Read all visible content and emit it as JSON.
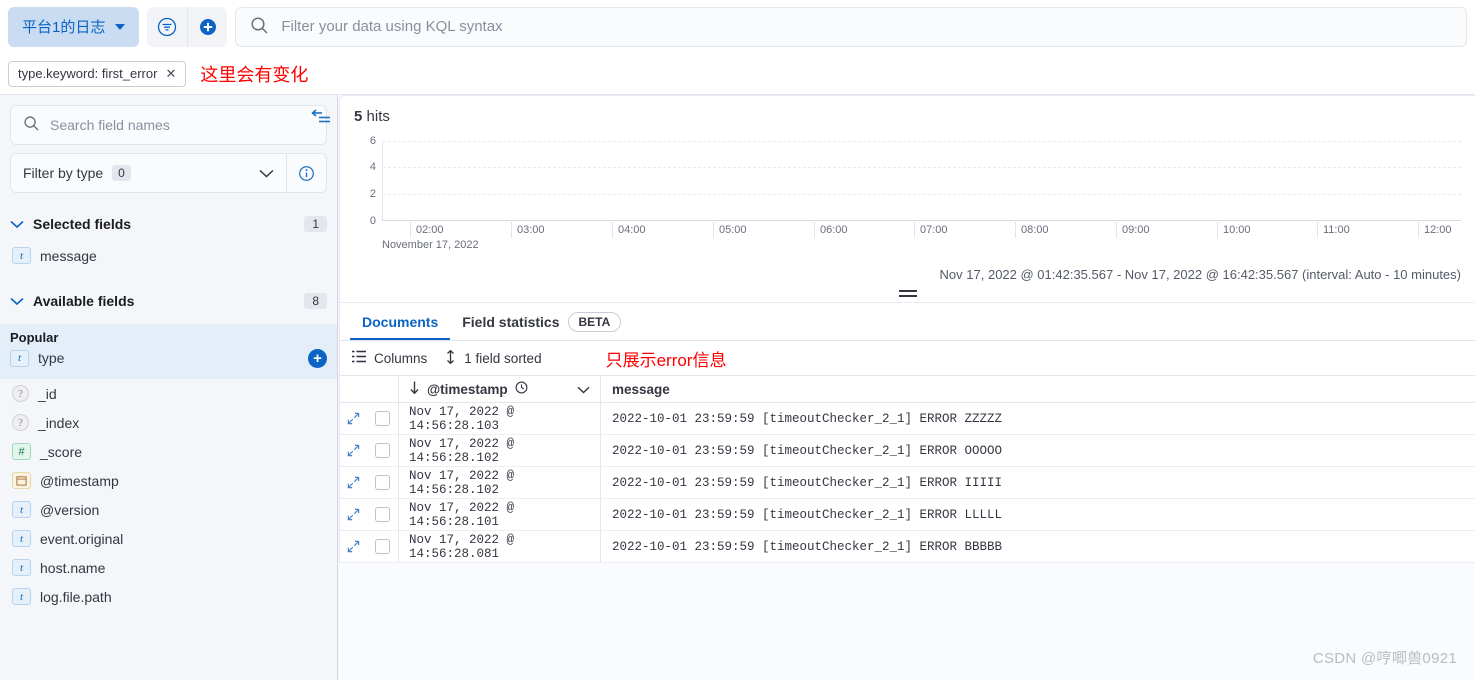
{
  "query_bar": {
    "data_view_label": "平台1的日志",
    "data_view_icon": "chevron-down-icon",
    "filter_icon": "filter-funnel-icon",
    "add_filter_icon": "add-plus-icon",
    "search_icon": "search-icon",
    "kql_placeholder": "Filter your data using KQL syntax",
    "kql_value": ""
  },
  "filter_bar": {
    "filters": [
      {
        "label": "type.keyword: first_error",
        "remove_icon": "close-x-icon"
      }
    ],
    "annotation": "这里会有变化",
    "annotation_color": "#FF0000"
  },
  "sidebar": {
    "search_placeholder": "Search field names",
    "search_value": "",
    "search_icon": "search-icon",
    "type_filter_label": "Filter by type",
    "type_filter_count": "0",
    "type_filter_caret": "chevron-down-icon",
    "info_icon": "info-circle-icon",
    "collapse_icon": "collapse-sidebar-icon",
    "sections": [
      {
        "title": "Selected fields",
        "count": "1",
        "collapse_icon": "chevron-down-icon",
        "fields": [
          {
            "name": "message",
            "type": "t"
          }
        ]
      },
      {
        "title": "Available fields",
        "count": "8",
        "collapse_icon": "chevron-down-icon",
        "popular_label": "Popular",
        "popular_fields": [
          {
            "name": "type",
            "type": "t",
            "add_icon": "add-field-icon"
          }
        ],
        "fields": [
          {
            "name": "_id",
            "type": "q",
            "glyph": "?"
          },
          {
            "name": "_index",
            "type": "q",
            "glyph": "?"
          },
          {
            "name": "_score",
            "type": "num",
            "glyph": "#"
          },
          {
            "name": "@timestamp",
            "type": "date",
            "glyph": "▤"
          },
          {
            "name": "@version",
            "type": "t",
            "glyph": "t"
          },
          {
            "name": "event.original",
            "type": "t",
            "glyph": "t"
          },
          {
            "name": "host.name",
            "type": "t",
            "glyph": "t"
          },
          {
            "name": "log.file.path",
            "type": "t",
            "glyph": "t"
          }
        ]
      }
    ]
  },
  "histogram": {
    "hits_count": "5",
    "hits_label": "hits",
    "time_range_text": "Nov 17, 2022 @ 01:42:35.567 - Nov 17, 2022 @ 16:42:35.567 (interval: Auto - 10 minutes)",
    "date_label": "November 17, 2022",
    "resize_handle_icon": "drag-handle-icon"
  },
  "chart_data": {
    "type": "bar",
    "title": "5 hits",
    "xlabel": "November 17, 2022",
    "ylabel": "",
    "categories": [
      "02:00",
      "03:00",
      "04:00",
      "05:00",
      "06:00",
      "07:00",
      "08:00",
      "09:00",
      "10:00",
      "11:00",
      "12:00"
    ],
    "values": [
      0,
      0,
      0,
      0,
      0,
      0,
      0,
      0,
      0,
      0,
      0
    ],
    "yticks": [
      0,
      2,
      4,
      6
    ],
    "ylim": [
      0,
      6
    ],
    "grid": true,
    "legend": "none",
    "interval": "Auto - 10 minutes"
  },
  "tabs": [
    {
      "label": "Documents",
      "active": true
    },
    {
      "label": "Field statistics",
      "active": false
    }
  ],
  "beta_badge": "BETA",
  "toolbar": {
    "columns_label": "Columns",
    "columns_icon": "columns-list-icon",
    "sort_label": "1 field sorted",
    "sort_icon": "sort-updown-icon",
    "annotation": "只展示error信息",
    "annotation_color": "#FF0000"
  },
  "table": {
    "columns": [
      {
        "label": "@timestamp",
        "sort_icon": "arrow-down-icon",
        "clock_icon": "clock-icon",
        "menu_icon": "chevron-down-icon"
      },
      {
        "label": "message"
      }
    ],
    "rows": [
      {
        "expand_icon": "expand-icon",
        "timestamp": "Nov 17, 2022 @ 14:56:28.103",
        "message": "2022-10-01 23:59:59 [timeoutChecker_2_1] ERROR ZZZZZ"
      },
      {
        "expand_icon": "expand-icon",
        "timestamp": "Nov 17, 2022 @ 14:56:28.102",
        "message": "2022-10-01 23:59:59 [timeoutChecker_2_1] ERROR OOOOO"
      },
      {
        "expand_icon": "expand-icon",
        "timestamp": "Nov 17, 2022 @ 14:56:28.102",
        "message": "2022-10-01 23:59:59 [timeoutChecker_2_1] ERROR IIIII"
      },
      {
        "expand_icon": "expand-icon",
        "timestamp": "Nov 17, 2022 @ 14:56:28.101",
        "message": "2022-10-01 23:59:59 [timeoutChecker_2_1] ERROR LLLLL"
      },
      {
        "expand_icon": "expand-icon",
        "timestamp": "Nov 17, 2022 @ 14:56:28.081",
        "message": "2022-10-01 23:59:59 [timeoutChecker_2_1] ERROR BBBBB"
      }
    ]
  },
  "watermark": "CSDN @哼唧兽0921",
  "colors": {
    "accent": "#0B64C4",
    "pill_bg": "#C9DCF2",
    "note_red": "#FF0000"
  }
}
